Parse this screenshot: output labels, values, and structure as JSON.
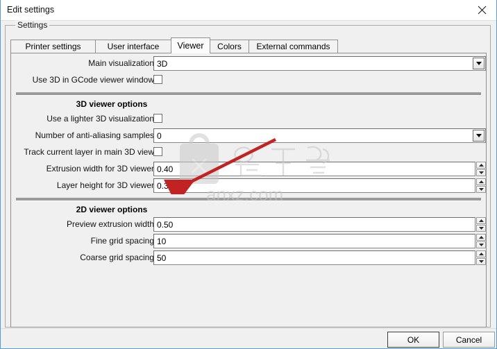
{
  "window": {
    "title": "Edit settings",
    "close_icon": "close-icon"
  },
  "groupbox": {
    "title": "Settings"
  },
  "tabs": [
    {
      "label": "Printer settings",
      "selected": false
    },
    {
      "label": "User interface",
      "selected": false
    },
    {
      "label": "Viewer",
      "selected": true
    },
    {
      "label": "Colors",
      "selected": false
    },
    {
      "label": "External commands",
      "selected": false
    }
  ],
  "viewer_page": {
    "top_rows": [
      {
        "label": "Main visualization",
        "type": "combo",
        "value": "3D"
      },
      {
        "label": "Use 3D in GCode viewer window",
        "type": "checkbox",
        "checked": false
      }
    ],
    "sections": [
      {
        "header": "3D viewer options",
        "rows": [
          {
            "label": "Use a lighter 3D visualization",
            "type": "checkbox",
            "checked": false
          },
          {
            "label": "Number of anti-aliasing samples",
            "type": "combo",
            "value": "0"
          },
          {
            "label": "Track current layer in main 3D view",
            "type": "checkbox",
            "checked": false
          },
          {
            "label": "Extrusion width for 3D viewer",
            "type": "spin",
            "value": "0.40"
          },
          {
            "label": "Layer height for 3D viewer",
            "type": "spin",
            "value": "0.30"
          }
        ]
      },
      {
        "header": "2D viewer options",
        "rows": [
          {
            "label": "Preview extrusion width",
            "type": "spin",
            "value": "0.50"
          },
          {
            "label": "Fine grid spacing",
            "type": "spin",
            "value": "10"
          },
          {
            "label": "Coarse grid spacing",
            "type": "spin",
            "value": "50"
          }
        ]
      }
    ]
  },
  "buttons": {
    "ok": "OK",
    "cancel": "Cancel"
  },
  "watermark": {
    "text": "anxz.com",
    "cjk": "安下载"
  },
  "colors": {
    "window_bg": "#f0f0f0",
    "titlebar_bg": "#ffffff",
    "window_border": "#5b9bd5",
    "field_bg": "#ffffff",
    "separator": "#9b9b9b",
    "arrow_red": "#c32222"
  }
}
